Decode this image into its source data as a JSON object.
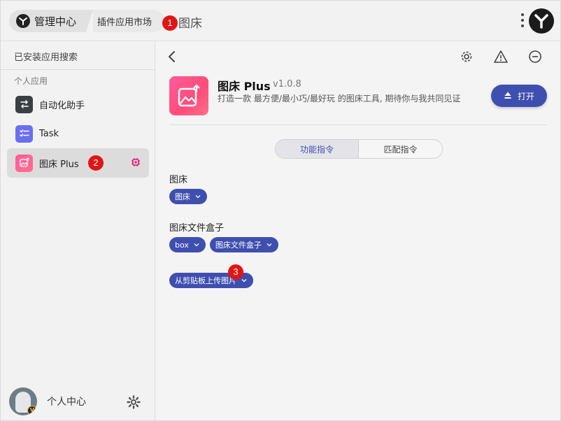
{
  "topbar": {
    "home_label": "管理中心",
    "breadcrumb": "插件应用市场",
    "close_glyph": "×",
    "current": "图床",
    "badge1": "1"
  },
  "sidebar": {
    "search_placeholder": "已安装应用搜索",
    "group_label": "个人应用",
    "items": [
      {
        "label": "自动化助手",
        "icon": "automation-icon"
      },
      {
        "label": "Task",
        "icon": "task-list-icon"
      },
      {
        "label": "图床 Plus",
        "icon": "image-upload-icon"
      }
    ],
    "badge2": "2",
    "profile_name": "个人中心",
    "avatar_badge": "V"
  },
  "plugin": {
    "name": "图床 Plus",
    "version": "v1.0.8",
    "description": "打造一款 最方便/最小巧/最好玩 的图床工具, 期待你与我共同见证",
    "open_label": "打开"
  },
  "tabs": {
    "function": "功能指令",
    "match": "匹配指令"
  },
  "commands": [
    {
      "title": "图床",
      "chips": [
        "图床"
      ]
    },
    {
      "title": "图床文件盒子",
      "chips": [
        "box",
        "图床文件盒子"
      ]
    },
    {
      "title": "",
      "chips": [
        "从剪贴板上传图片"
      ]
    }
  ],
  "badge3": "3",
  "colors": {
    "accent": "#3f4fb0",
    "badge": "#e01515",
    "plugin_gradient": "#ff5a9a"
  }
}
